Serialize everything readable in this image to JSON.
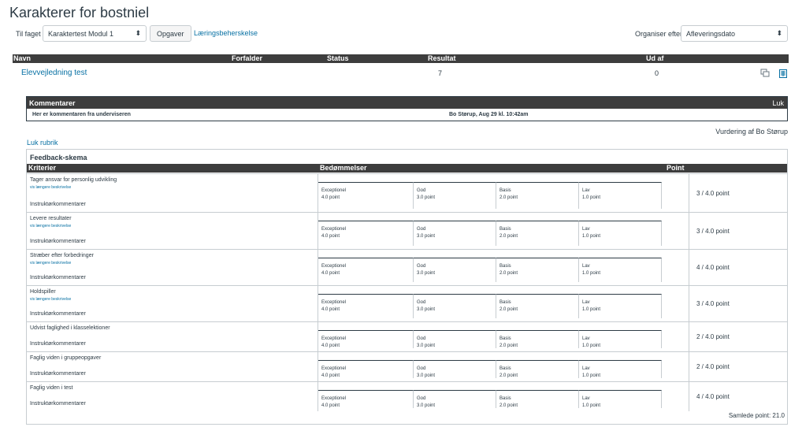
{
  "page": {
    "title": "Karakterer for bostniel"
  },
  "controls": {
    "course_label": "Til faget",
    "course_value": "Karaktertest Modul 1",
    "assignments_button": "Opgaver",
    "learning_mastery_link": "Læringsbeherskelse",
    "organize_label": "Organiser efter",
    "organize_value": "Afleveringsdato"
  },
  "grades_table": {
    "headers": {
      "name": "Navn",
      "due": "Forfalder",
      "status": "Status",
      "score": "Resultat",
      "out_of": "Ud af"
    },
    "row": {
      "name": "Elevvejledning test",
      "score": "7",
      "out_of": "0"
    }
  },
  "comments": {
    "title": "Kommentarer",
    "close": "Luk",
    "text": "Her er kommentaren fra underviseren",
    "author_date": "Bo Størup, Aug 29 kl. 10:42am"
  },
  "assessment": {
    "assessor": "Vurdering af Bo Størup",
    "close_rubric": "Luk rubrik"
  },
  "rubric": {
    "title": "Feedback-skema",
    "headers": {
      "criteria": "Kriterier",
      "ratings": "Bedømmelser",
      "points": "Point"
    },
    "more_text": "vis længere beskrivelse",
    "instructor_comments": "Instruktørkommentarer",
    "rating_levels": [
      {
        "name": "Exceptionel",
        "points": "4.0 point"
      },
      {
        "name": "God",
        "points": "3.0 point"
      },
      {
        "name": "Basis",
        "points": "2.0 point"
      },
      {
        "name": "Lav",
        "points": "1.0 point"
      }
    ],
    "criteria": [
      {
        "name": "Tager ansvar for personlig udvikling",
        "has_more": true,
        "score": "3 / 4.0 point"
      },
      {
        "name": "Levere resultater",
        "has_more": true,
        "score": "3 / 4.0 point"
      },
      {
        "name": "Stræber efter forbedringer",
        "has_more": true,
        "score": "4 / 4.0 point"
      },
      {
        "name": "Holdspiller",
        "has_more": true,
        "score": "3 / 4.0 point"
      },
      {
        "name": "Udvist faglighed i klasselektioner",
        "has_more": false,
        "score": "2 / 4.0 point"
      },
      {
        "name": "Faglig viden i gruppeopgaver",
        "has_more": false,
        "score": "2 / 4.0 point"
      },
      {
        "name": "Faglig viden i test",
        "has_more": false,
        "score": "4 / 4.0 point"
      }
    ],
    "total": "Samlede point: 21.0"
  },
  "colors": {
    "link": "#0770a3",
    "header_bg": "#3d3d3d",
    "text": "#2d3b45"
  },
  "icons": [
    "comment-icon",
    "rubric-icon",
    "select-arrow-icon"
  ]
}
